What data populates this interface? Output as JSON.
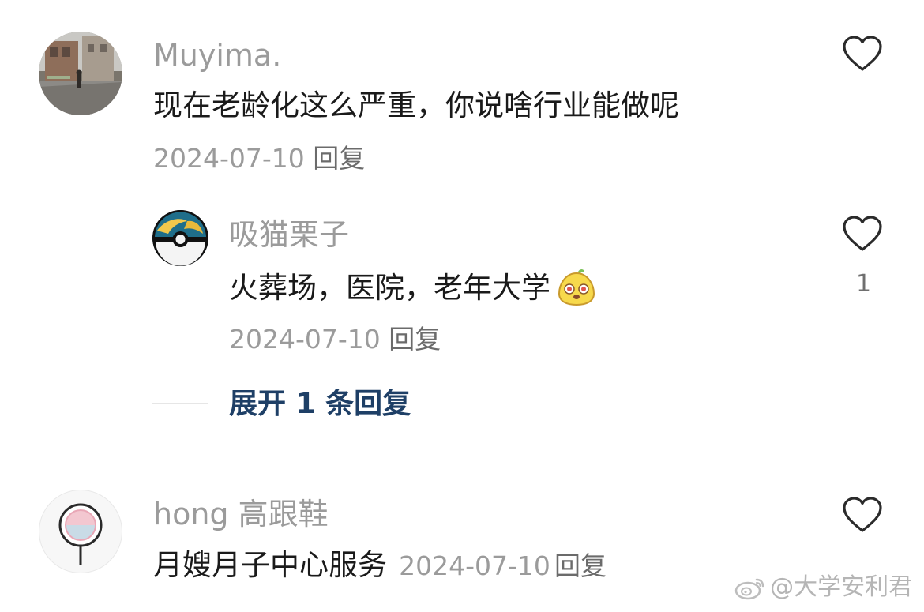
{
  "comments": [
    {
      "username": "Muyima.",
      "text": "现在老龄化这么严重，你说啥行业能做呢",
      "date": "2024-07-10",
      "reply_label": "回复"
    },
    {
      "username": "吸猫栗子",
      "text": "火葬场，医院，老年大学",
      "date": "2024-07-10",
      "reply_label": "回复",
      "like_count": "1",
      "expand_label": "展开 1 条回复"
    },
    {
      "username": "hong 高跟鞋",
      "text": "月嫂月子中心服务",
      "date": "2024-07-10",
      "reply_label": "回复"
    }
  ],
  "watermark": "@大学安利君",
  "colors": {
    "username": "#9b9b9b",
    "text": "#1a1a1a",
    "meta": "#9b9b9b",
    "expand_link": "#1e3f66"
  },
  "icons": [
    "heart-outline-icon",
    "sticker-emoji-icon",
    "weibo-logo-icon"
  ]
}
